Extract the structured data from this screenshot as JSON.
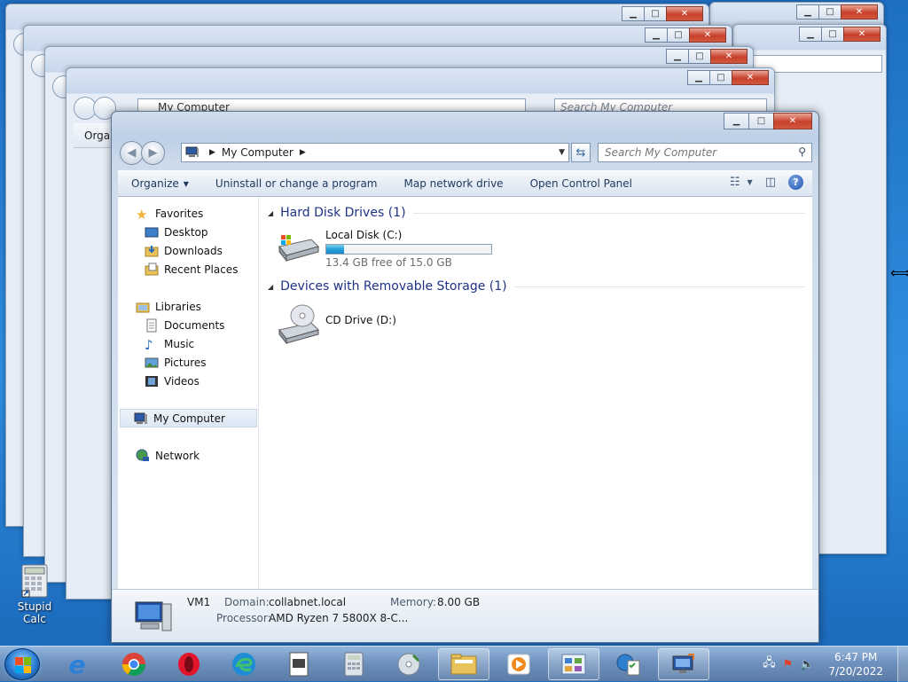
{
  "window": {
    "location": "My Computer",
    "search_placeholder": "Search My Computer",
    "caption_buttons": {
      "minimize": "▁",
      "maximize": "□",
      "close": "✕"
    }
  },
  "background_windows": {
    "location": "My Computer",
    "search_placeholder": "Search My Computer",
    "organize": "Organi"
  },
  "toolbar": {
    "organize": "Organize",
    "uninstall": "Uninstall or change a program",
    "map_drive": "Map network drive",
    "control_panel": "Open Control Panel"
  },
  "navigation": {
    "favorites": "Favorites",
    "desktop": "Desktop",
    "downloads": "Downloads",
    "recent": "Recent Places",
    "libraries": "Libraries",
    "documents": "Documents",
    "music": "Music",
    "pictures": "Pictures",
    "videos": "Videos",
    "computer": "My Computer",
    "network": "Network"
  },
  "groups": {
    "hdd": "Hard Disk Drives (1)",
    "removable": "Devices with Removable Storage (1)"
  },
  "drives": {
    "local_name": "Local Disk (C:)",
    "local_free": "13.4 GB free of 15.0 GB",
    "local_used_fraction": 0.107,
    "cd_name": "CD Drive (D:)"
  },
  "details": {
    "computer_name": "VM1",
    "domain_label": "Domain:",
    "domain": "collabnet.local",
    "memory_label": "Memory:",
    "memory": "8.00 GB",
    "processor_label": "Processor:",
    "processor": "AMD Ryzen 7 5800X 8-C..."
  },
  "desktop": {
    "icon_label": "Stupid Calc"
  },
  "taskbar": {
    "time": "6:47 PM",
    "date": "7/20/2022"
  },
  "colors": {
    "group_header": "#1e3287",
    "usage_bar": "#26a0da",
    "close_button": "#c7402b"
  }
}
